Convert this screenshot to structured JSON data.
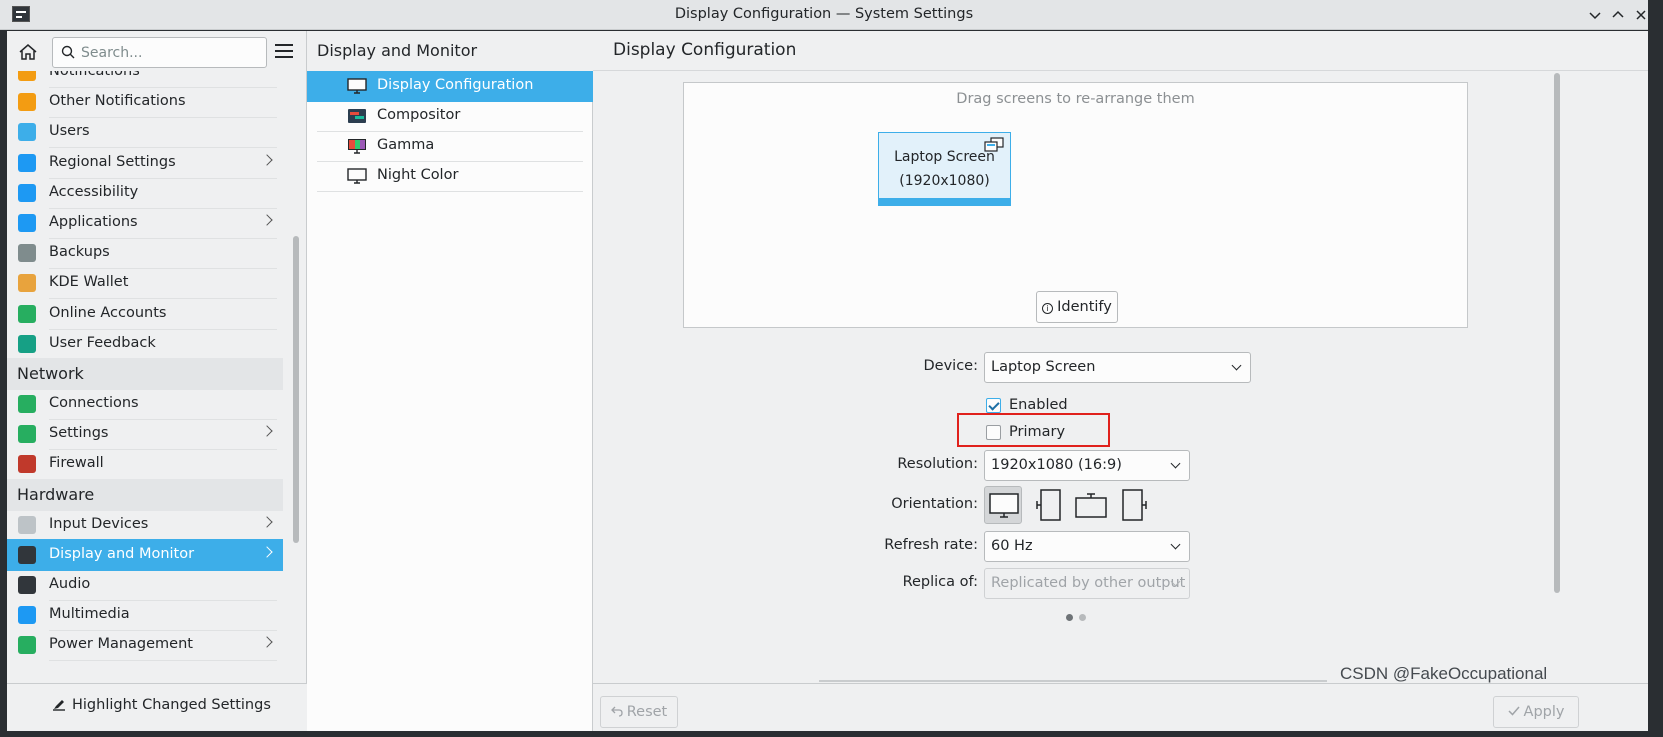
{
  "window": {
    "title": "Display Configuration — System Settings",
    "controls": [
      "minimize",
      "maximize",
      "close"
    ]
  },
  "sidebar": {
    "search_placeholder": "Search...",
    "items": [
      {
        "type": "item",
        "label": "Notifications",
        "icon": "bell-icon",
        "color": "#f39c12",
        "chevron": false
      },
      {
        "type": "item",
        "label": "Other Notifications",
        "icon": "bell-icon",
        "color": "#f39c12",
        "chevron": false
      },
      {
        "type": "item",
        "label": "Users",
        "icon": "users-icon",
        "color": "#3daee9",
        "chevron": false
      },
      {
        "type": "item",
        "label": "Regional Settings",
        "icon": "flag-icon",
        "color": "#1d99f3",
        "chevron": true
      },
      {
        "type": "item",
        "label": "Accessibility",
        "icon": "accessibility-icon",
        "color": "#1d99f3",
        "chevron": false
      },
      {
        "type": "item",
        "label": "Applications",
        "icon": "applications-icon",
        "color": "#1d99f3",
        "chevron": true
      },
      {
        "type": "item",
        "label": "Backups",
        "icon": "backups-icon",
        "color": "#7f8c8d",
        "chevron": false
      },
      {
        "type": "item",
        "label": "KDE Wallet",
        "icon": "wallet-icon",
        "color": "#e8a33d",
        "chevron": false
      },
      {
        "type": "item",
        "label": "Online Accounts",
        "icon": "globe-icon",
        "color": "#27ae60",
        "chevron": false
      },
      {
        "type": "item",
        "label": "User Feedback",
        "icon": "feedback-icon",
        "color": "#16a085",
        "chevron": false
      },
      {
        "type": "category",
        "label": "Network"
      },
      {
        "type": "item",
        "label": "Connections",
        "icon": "globe-icon",
        "color": "#27ae60",
        "chevron": false
      },
      {
        "type": "item",
        "label": "Settings",
        "icon": "globe-icon",
        "color": "#27ae60",
        "chevron": true
      },
      {
        "type": "item",
        "label": "Firewall",
        "icon": "firewall-icon",
        "color": "#c0392b",
        "chevron": false
      },
      {
        "type": "category",
        "label": "Hardware"
      },
      {
        "type": "item",
        "label": "Input Devices",
        "icon": "mouse-icon",
        "color": "#bdc3c7",
        "chevron": true
      },
      {
        "type": "item",
        "label": "Display and Monitor",
        "icon": "monitor-icon",
        "color": "#31363b",
        "chevron": true,
        "selected": true
      },
      {
        "type": "item",
        "label": "Audio",
        "icon": "speaker-icon",
        "color": "#31363b",
        "chevron": false
      },
      {
        "type": "item",
        "label": "Multimedia",
        "icon": "multimedia-icon",
        "color": "#1d99f3",
        "chevron": false
      },
      {
        "type": "item",
        "label": "Power Management",
        "icon": "power-icon",
        "color": "#27ae60",
        "chevron": true
      }
    ],
    "highlight_button": "Highlight Changed Settings"
  },
  "middle": {
    "header": "Display and Monitor",
    "items": [
      {
        "label": "Display Configuration",
        "icon": "monitor-icon",
        "selected": true
      },
      {
        "label": "Compositor",
        "icon": "compositor-icon",
        "selected": false
      },
      {
        "label": "Gamma",
        "icon": "gamma-icon",
        "selected": false
      },
      {
        "label": "Night Color",
        "icon": "monitor-icon",
        "selected": false
      }
    ]
  },
  "panel": {
    "title": "Display Configuration",
    "drag_hint": "Drag screens to re-arrange them",
    "screen": {
      "name": "Laptop Screen",
      "resolution": "(1920x1080)"
    },
    "identify_label": "Identify",
    "device_label": "Device:",
    "device_value": "Laptop Screen",
    "enabled_label": "Enabled",
    "enabled": true,
    "primary_label": "Primary",
    "primary": false,
    "resolution_label": "Resolution:",
    "resolution_value": "1920x1080 (16:9)",
    "orientation_label": "Orientation:",
    "orientation_options": [
      "landscape",
      "portrait-left",
      "landscape-inverted",
      "portrait-right"
    ],
    "orientation_selected": 0,
    "refresh_label": "Refresh rate:",
    "refresh_value": "60 Hz",
    "replica_label": "Replica of:",
    "replica_value": "Replicated by other output",
    "page_dots": 2,
    "page_active": 0,
    "reset_label": "Reset",
    "apply_label": "Apply"
  },
  "watermark": "CSDN @FakeOccupational",
  "colors": {
    "accent": "#3daee9",
    "highlight_box": "#e0211c"
  }
}
